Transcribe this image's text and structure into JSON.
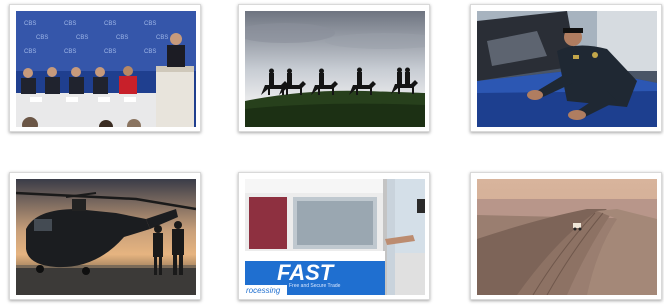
{
  "photos": [
    {
      "id": 1,
      "subject": "press-conference",
      "backdrop_text": "CBS",
      "bg": "#1f3f8f"
    },
    {
      "id": 2,
      "subject": "horse-riders-silhouette"
    },
    {
      "id": 3,
      "subject": "officer-inspecting-vehicle"
    },
    {
      "id": 4,
      "subject": "helicopter-sunset"
    },
    {
      "id": 5,
      "subject": "fast-lane-booth",
      "sign": {
        "title": "FAST",
        "subtitle": "Free and Secure Trade",
        "footer": "rocessing"
      },
      "accent": "#1f6fd0"
    },
    {
      "id": 6,
      "subject": "desert-tire-tracks"
    }
  ]
}
